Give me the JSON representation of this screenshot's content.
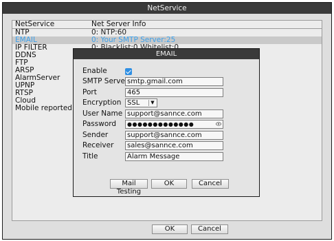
{
  "window": {
    "title": "NetService"
  },
  "list": {
    "headers": [
      "NetService",
      "Net Server Info"
    ],
    "rows": [
      {
        "name": "NTP",
        "info": "0: NTP:60",
        "selected": false
      },
      {
        "name": "EMAIL",
        "info": "0: Your SMTP Server:25",
        "selected": true
      },
      {
        "name": "IP FILTER",
        "info": "0: Blacklist:0 Whitelist:0",
        "selected": false
      },
      {
        "name": "DDNS",
        "info": "",
        "selected": false
      },
      {
        "name": "FTP",
        "info": "",
        "selected": false
      },
      {
        "name": "ARSP",
        "info": "",
        "selected": false
      },
      {
        "name": "AlarmServer",
        "info": "",
        "selected": false
      },
      {
        "name": "UPNP",
        "info": "",
        "selected": false
      },
      {
        "name": "RTSP",
        "info": "",
        "selected": false
      },
      {
        "name": "Cloud",
        "info": "",
        "selected": false
      },
      {
        "name": "Mobile reported",
        "info": "",
        "selected": false
      }
    ]
  },
  "dialog": {
    "title": "EMAIL",
    "enable_label": "Enable",
    "enable_checked": true,
    "smtp_label": "SMTP Server",
    "smtp_value": "smtp.gmail.com",
    "port_label": "Port",
    "port_value": "465",
    "encryption_label": "Encryption",
    "encryption_value": "SSL",
    "username_label": "User Name",
    "username_value": "support@sannce.com",
    "password_label": "Password",
    "password_value": "●●●●●●●●●●●●●",
    "sender_label": "Sender",
    "sender_value": "support@sannce.com",
    "receiver_label": "Receiver",
    "receiver_value": "sales@sannce.com",
    "title_label": "Title",
    "title_value": "Alarm Message",
    "mail_testing_label": "Mail Testing",
    "ok_label": "OK",
    "cancel_label": "Cancel"
  },
  "footer": {
    "ok_label": "OK",
    "cancel_label": "Cancel"
  },
  "colors": {
    "accent": "#3da0ea",
    "titlebar": "#3a3a3a",
    "checkbox": "#2f8fe3"
  },
  "icons": {
    "enable": "checkmark-icon",
    "encryption": "chevron-down-icon",
    "password": "eye-icon"
  }
}
